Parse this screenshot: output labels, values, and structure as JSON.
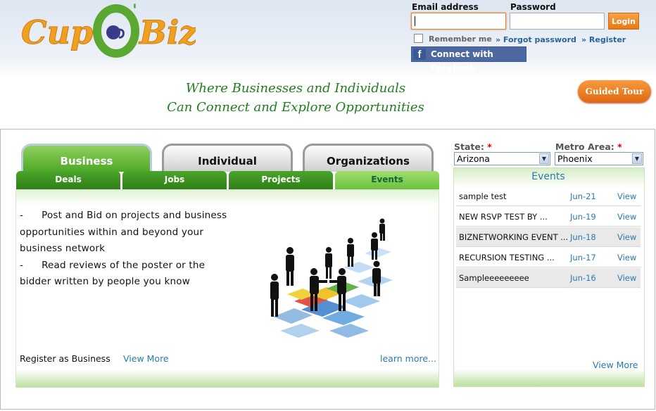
{
  "logo": {
    "text_left": "Cup",
    "text_mid": "O'",
    "text_right": "Biz"
  },
  "header": {
    "tagline_line1": "Where Businesses and Individuals",
    "tagline_line2": "Can Connect and Explore Opportunities",
    "email_label": "Email address",
    "password_label": "Password",
    "email_value": "",
    "password_value": "",
    "login_label": "Login",
    "remember_label": "Remember me",
    "forgot_label": "» Forgot password",
    "register_label": "» Register",
    "facebook_label": "Connect with Facebook",
    "guided_tour_label": "Guided Tour"
  },
  "tabs": [
    {
      "label": "Business",
      "active": true
    },
    {
      "label": "Individual",
      "active": false
    },
    {
      "label": "Organizations",
      "active": false
    }
  ],
  "subtabs": [
    {
      "label": "Deals",
      "active": false
    },
    {
      "label": "Jobs",
      "active": false
    },
    {
      "label": "Projects",
      "active": false
    },
    {
      "label": "Events",
      "active": true
    }
  ],
  "panel": {
    "bullet1_dash": "-",
    "bullet1_line1": "Post and Bid on projects and business",
    "bullet1_line2": "opportunities within and beyond your",
    "bullet1_line3": "business network",
    "bullet2_dash": "-",
    "bullet2_line1": "Read reviews of the poster or the",
    "bullet2_line2": "bidder written by people you know",
    "register_label": "Register as Business",
    "view_more_label": "View More",
    "learn_more_label": "learn more..."
  },
  "filters": {
    "state_label": "State:",
    "metro_label": "Metro Area:",
    "required_mark": "*",
    "state_value": "Arizona",
    "metro_value": "Phoenix"
  },
  "events": {
    "title": "Events",
    "items": [
      {
        "name": "sample test",
        "date": "Jun-21",
        "action": "View"
      },
      {
        "name": "NEW RSVP TEST BY ...",
        "date": "Jun-19",
        "action": "View"
      },
      {
        "name": "BIZNETWORKING EVENT ...",
        "date": "Jun-18",
        "action": "View"
      },
      {
        "name": "RECURSION TESTING ...",
        "date": "Jun-17",
        "action": "View"
      },
      {
        "name": "Sampleeeeeeeee",
        "date": "Jun-16",
        "action": "View"
      }
    ],
    "view_more_label": "View More"
  },
  "colors": {
    "brand_green": "#4ea826",
    "brand_orange": "#e9833a",
    "link_blue": "#2a7ab0",
    "facebook_blue": "#3b5998"
  }
}
